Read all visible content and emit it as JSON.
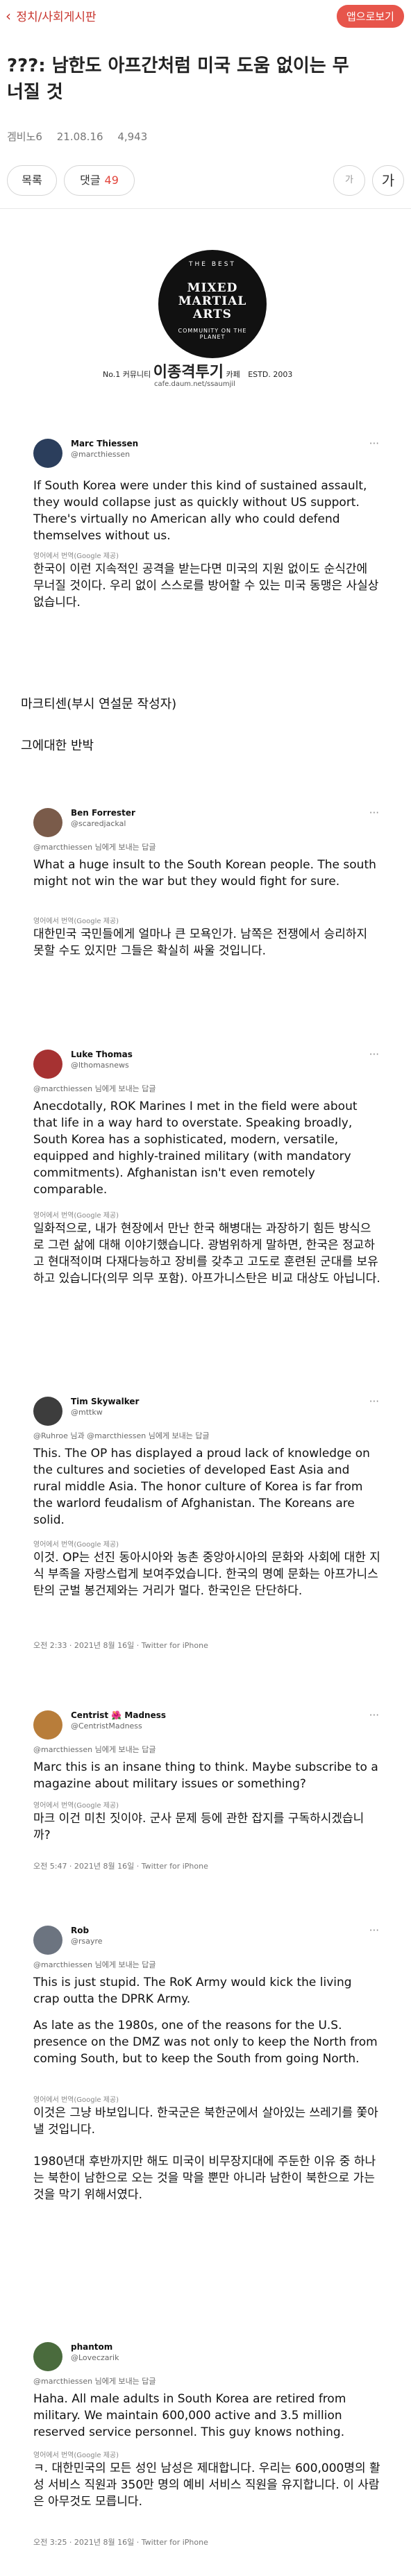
{
  "header": {
    "back_label": "정치/사회게시판",
    "open_app_label": "앱으로보기"
  },
  "post": {
    "title_line1": "???: 남한도 아프간처럼 미국 도움 없이는 무",
    "title_line2": "너질 것",
    "author": "겜비노6",
    "date": "21.08.16",
    "views": "4,943"
  },
  "actions": {
    "list_label": "목록",
    "comments_label": "댓글",
    "comments_count": "49",
    "font_small": "가",
    "font_large": "가"
  },
  "cafe_logo": {
    "line_top": "THE BEST",
    "line1": "MIXED",
    "line2": "MARTIAL",
    "line3": "ARTS",
    "line_bottom": "COMMUNITY ON THE PLANET",
    "rank": "No.1 커뮤니티",
    "name": "이종격투기",
    "suffix": "카페",
    "est": "ESTD. 2003",
    "url": "cafe.daum.net/ssaumjil"
  },
  "body_text": {
    "caption1": "마크티센(부시 연설문 작성자)",
    "caption2": "그에대한 반박"
  },
  "tweets": [
    {
      "name": "Marc Thiessen",
      "handle": "@marcthiessen",
      "reply_to": "",
      "en": "If South Korea were under this kind of sustained assault, they would collapse just as quickly without US support. There's virtually no American ally who could defend themselves without us.",
      "translated_by": "영어에서 번역(Google 제공)",
      "ko": "한국이 이런 지속적인 공격을 받는다면 미국의 지원 없이도 순식간에 무너질 것이다. 우리 없이 스스로를 방어할 수 있는 미국 동맹은 사실상 없습니다.",
      "footer": ""
    },
    {
      "name": "Ben Forrester",
      "handle": "@scaredjackal",
      "reply_to": "@marcthiessen 님에게 보내는 답글",
      "en": "What a huge insult to the South Korean people. The south might not win the war but they would fight for sure.",
      "translated_by": "영어에서 번역(Google 제공)",
      "ko": "대한민국 국민들에게 얼마나 큰 모욕인가. 남쪽은 전쟁에서 승리하지 못할 수도 있지만 그들은 확실히 싸울 것입니다.",
      "footer": ""
    },
    {
      "name": "Luke Thomas",
      "handle": "@lthomasnews",
      "reply_to": "@marcthiessen 님에게 보내는 답글",
      "en": "Anecdotally, ROK Marines I met in the field were about that life in a way hard to overstate. Speaking broadly, South Korea has a sophisticated, modern, versatile, equipped and highly-trained military (with mandatory commitments). Afghanistan isn't even remotely comparable.",
      "translated_by": "영어에서 번역(Google 제공)",
      "ko": "일화적으로, 내가 현장에서 만난 한국 해병대는 과장하기 힘든 방식으로 그런 삶에 대해 이야기했습니다. 광범위하게 말하면, 한국은 정교하고 현대적이며 다재다능하고 장비를 갖추고 고도로 훈련된 군대를 보유하고 있습니다(의무 의무 포함). 아프가니스탄은 비교 대상도 아닙니다.",
      "footer": ""
    },
    {
      "name": "Tim Skywalker",
      "handle": "@mttkw",
      "reply_to": "@Ruhroe 님과 @marcthiessen 님에게 보내는 답글",
      "en": "This. The OP has displayed a proud lack of knowledge on the cultures and societies of developed East Asia and rural middle Asia. The honor culture of Korea is far from the warlord feudalism of Afghanistan. The Koreans are solid.",
      "translated_by": "영어에서 번역(Google 제공)",
      "ko": "이것. OP는 선진 동아시아와 농촌 중앙아시아의 문화와 사회에 대한 지식 부족을 자랑스럽게 보여주었습니다. 한국의 명예 문화는 아프가니스탄의 군벌 봉건제와는 거리가 멀다. 한국인은 단단하다.",
      "footer": "오전 2:33 · 2021년 8월 16일 · Twitter for iPhone"
    },
    {
      "name": "Centrist 🌺 Madness",
      "handle": "@CentristMadness",
      "reply_to": "@marcthiessen 님에게 보내는 답글",
      "en": "Marc this is an insane thing to think. Maybe subscribe to a magazine about military issues or something?",
      "translated_by": "영어에서 번역(Google 제공)",
      "ko": "마크 이건 미친 짓이야. 군사 문제 등에 관한 잡지를 구독하시겠습니까?",
      "footer": "오전 5:47 · 2021년 8월 16일 · Twitter for iPhone"
    },
    {
      "name": "Rob",
      "handle": "@rsayre",
      "reply_to": "@marcthiessen 님에게 보내는 답글",
      "en": "This is just stupid. The RoK Army would kick the living crap outta the DPRK Army.",
      "en2": "As late as the 1980s, one of the reasons for the U.S. presence on the DMZ was not only to keep the North from coming South, but to keep the South from going North.",
      "translated_by": "영어에서 번역(Google 제공)",
      "ko": "이것은 그냥 바보입니다. 한국군은 북한군에서 살아있는 쓰레기를 쫓아낼 것입니다.",
      "ko2": "1980년대 후반까지만 해도 미국이 비무장지대에 주둔한 이유 중 하나는 북한이 남한으로 오는 것을 막을 뿐만 아니라 남한이 북한으로 가는 것을 막기 위해서였다.",
      "footer": ""
    },
    {
      "name": "phantom",
      "handle": "@Loveczarik",
      "reply_to": "@marcthiessen 님에게 보내는 답글",
      "en": "Haha. All male adults in South Korea are retired from military. We maintain 600,000 active and 3.5 million reserved service personnel. This guy knows nothing.",
      "translated_by": "영어에서 번역(Google 제공)",
      "ko": "ㅋ. 대한민국의 모든 성인 남성은 제대합니다. 우리는 600,000명의 활성 서비스 직원과 350만 명의 예비 서비스 직원을 유지합니다. 이 사람은 아무것도 모릅니다.",
      "footer": "오전 3:25 · 2021년 8월 16일 · Twitter for iPhone"
    }
  ]
}
